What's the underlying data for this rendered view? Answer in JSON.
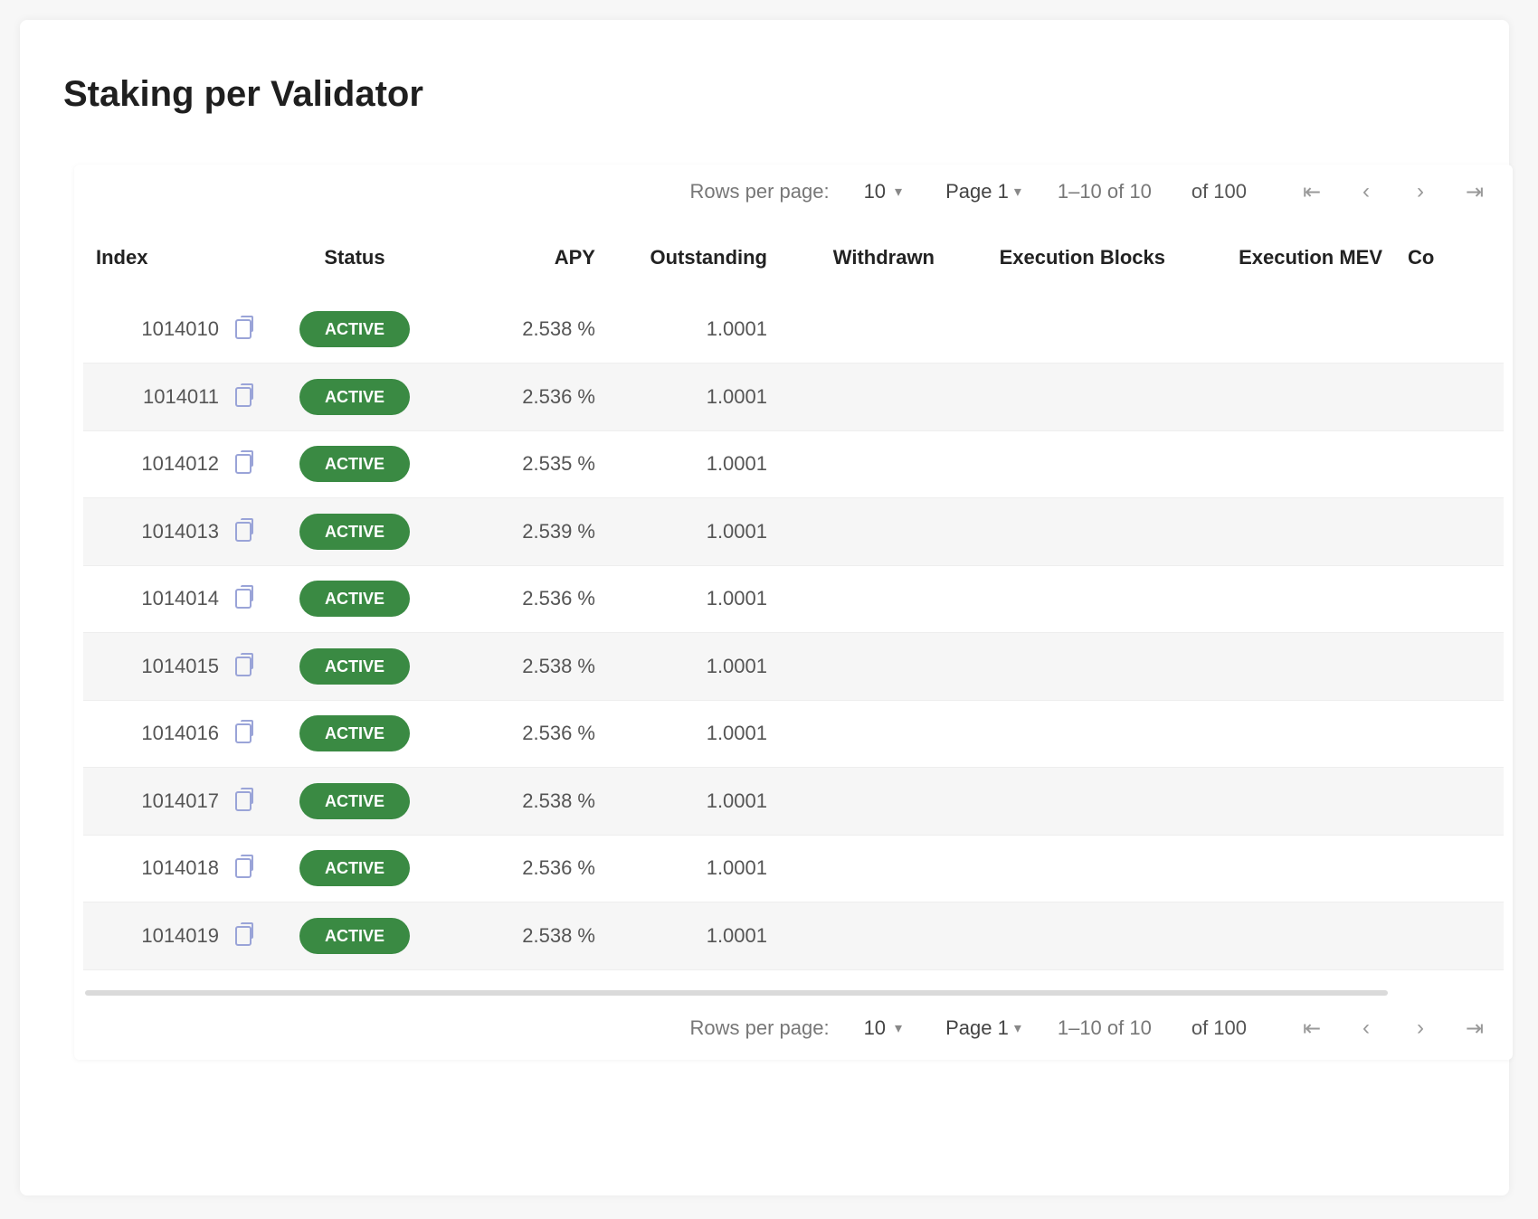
{
  "page": {
    "title": "Staking per Validator"
  },
  "pager": {
    "rows_per_page_label": "Rows per page:",
    "rows_per_page_value": "10",
    "page_label": "Page 1",
    "range_text": "1–10 of 10",
    "total_text": "of 100",
    "first_icon": "first-page-icon",
    "prev_icon": "prev-page-icon",
    "next_icon": "next-page-icon",
    "last_icon": "last-page-icon"
  },
  "table": {
    "columns": [
      "Index",
      "Status",
      "APY",
      "Outstanding",
      "Withdrawn",
      "Execution Blocks",
      "Execution MEV",
      "Co"
    ],
    "rows": [
      {
        "index": "1014010",
        "status": "ACTIVE",
        "apy": "2.538 %",
        "outstanding": "1.0001",
        "withdrawn": "",
        "exec_blocks": "",
        "exec_mev": "",
        "more": ""
      },
      {
        "index": "1014011",
        "status": "ACTIVE",
        "apy": "2.536 %",
        "outstanding": "1.0001",
        "withdrawn": "",
        "exec_blocks": "",
        "exec_mev": "",
        "more": ""
      },
      {
        "index": "1014012",
        "status": "ACTIVE",
        "apy": "2.535 %",
        "outstanding": "1.0001",
        "withdrawn": "",
        "exec_blocks": "",
        "exec_mev": "",
        "more": ""
      },
      {
        "index": "1014013",
        "status": "ACTIVE",
        "apy": "2.539 %",
        "outstanding": "1.0001",
        "withdrawn": "",
        "exec_blocks": "",
        "exec_mev": "",
        "more": ""
      },
      {
        "index": "1014014",
        "status": "ACTIVE",
        "apy": "2.536 %",
        "outstanding": "1.0001",
        "withdrawn": "",
        "exec_blocks": "",
        "exec_mev": "",
        "more": ""
      },
      {
        "index": "1014015",
        "status": "ACTIVE",
        "apy": "2.538 %",
        "outstanding": "1.0001",
        "withdrawn": "",
        "exec_blocks": "",
        "exec_mev": "",
        "more": ""
      },
      {
        "index": "1014016",
        "status": "ACTIVE",
        "apy": "2.536 %",
        "outstanding": "1.0001",
        "withdrawn": "",
        "exec_blocks": "",
        "exec_mev": "",
        "more": ""
      },
      {
        "index": "1014017",
        "status": "ACTIVE",
        "apy": "2.538 %",
        "outstanding": "1.0001",
        "withdrawn": "",
        "exec_blocks": "",
        "exec_mev": "",
        "more": ""
      },
      {
        "index": "1014018",
        "status": "ACTIVE",
        "apy": "2.536 %",
        "outstanding": "1.0001",
        "withdrawn": "",
        "exec_blocks": "",
        "exec_mev": "",
        "more": ""
      },
      {
        "index": "1014019",
        "status": "ACTIVE",
        "apy": "2.538 %",
        "outstanding": "1.0001",
        "withdrawn": "",
        "exec_blocks": "",
        "exec_mev": "",
        "more": ""
      }
    ]
  },
  "colors": {
    "status_active": "#3a8a43",
    "copy_icon": "#9aa4d8"
  },
  "icons": {
    "copy": "copy-icon"
  }
}
